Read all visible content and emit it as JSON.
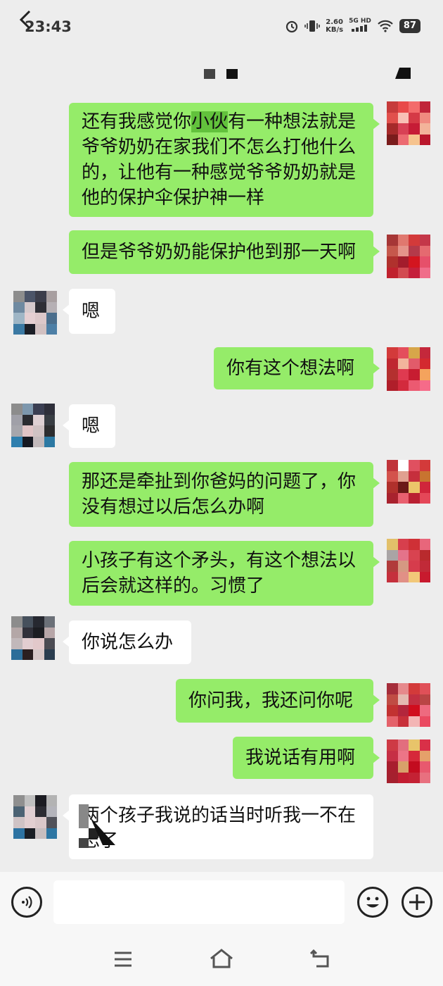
{
  "status": {
    "time": "23:43",
    "speed": "2.60",
    "speed_unit": "KB/s",
    "network": "5G HD",
    "battery": "87"
  },
  "colors": {
    "my_bubble": "#95ec69",
    "their_bubble": "#ffffff",
    "background": "#ededed",
    "highlight": "#62c23c"
  },
  "messages": [
    {
      "side": "me",
      "pre": "还有我感觉你",
      "hl": "小伙",
      "post": "有一种想法就是爷爷奶奶在家我们不怎么打他什么的，让他有一种感觉爷爷奶奶就是他的保护伞保护神一样"
    },
    {
      "side": "me",
      "text": "但是爷爷奶奶能保护他到那一天啊"
    },
    {
      "side": "them",
      "text": "嗯"
    },
    {
      "side": "me",
      "text": "你有这个想法啊"
    },
    {
      "side": "them",
      "text": "嗯"
    },
    {
      "side": "me",
      "text": "那还是牵扯到你爸妈的问题了，你没有想过以后怎么办啊"
    },
    {
      "side": "me",
      "text": "小孩子有这个矛头，有这个想法以后会就这样的。习惯了"
    },
    {
      "side": "them",
      "text": "你说怎么办"
    },
    {
      "side": "me",
      "text": "你问我，我还问你呢"
    },
    {
      "side": "me",
      "text": "我说话有用啊"
    },
    {
      "side": "them",
      "text": "两个孩子我说的话当时听我一不在忘了"
    }
  ],
  "icons": {
    "back": "chevron-left-icon",
    "more": "more-icon",
    "voice": "voice-icon",
    "emoji": "emoji-icon",
    "plus": "plus-icon"
  }
}
